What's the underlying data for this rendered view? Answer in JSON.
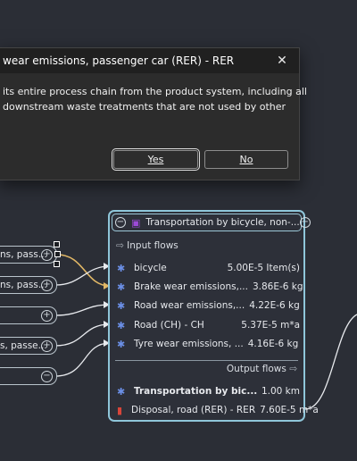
{
  "dialog": {
    "title": "wear emissions, passenger car (RER) - RER",
    "message_line1": "its entire process chain from the product system, including all",
    "message_line2": "downstream waste treatments that are not used by other",
    "yes_label": "Yes",
    "no_label": "No"
  },
  "stubs": [
    {
      "label": "ns, pass..."
    },
    {
      "label": "ns, pass..."
    },
    {
      "label": ""
    },
    {
      "label": "s, passe..."
    },
    {
      "label": ""
    }
  ],
  "node": {
    "title": "Transportation by bicycle, non-...",
    "input_label": "Input flows",
    "output_label": "Output flows",
    "inputs": [
      {
        "name": "bicycle",
        "amount": "5.00E-5 Item(s)"
      },
      {
        "name": "Brake wear emissions,...",
        "amount": "3.86E-6 kg"
      },
      {
        "name": "Road wear emissions,...",
        "amount": "4.22E-6 kg"
      },
      {
        "name": "Road (CH) - CH",
        "amount": "5.37E-5 m*a"
      },
      {
        "name": "Tyre wear emissions, ...",
        "amount": "4.16E-6 kg"
      }
    ],
    "outputs": [
      {
        "name": "Transportation by bic...",
        "amount": "1.00 km",
        "icon": "flow-icon"
      },
      {
        "name": "Disposal, road (RER) - RER",
        "amount": "7.60E-5 m*a",
        "icon": "waste-bin-icon"
      }
    ]
  },
  "colors": {
    "background": "#2b2e36",
    "node_border": "#8fc6da",
    "link_highlight": "#e2b866",
    "link": "#e8eaee",
    "flow_icon": "#6b8fe6",
    "waste_icon": "#d8453a",
    "process_icon": "#9c4ad8"
  }
}
